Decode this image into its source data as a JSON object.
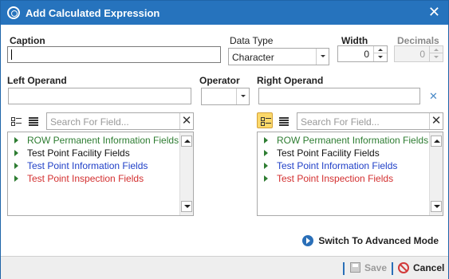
{
  "window": {
    "title": "Add Calculated Expression",
    "close_glyph": "✕"
  },
  "caption": {
    "label": "Caption",
    "value": ""
  },
  "data_type": {
    "label": "Data Type",
    "value": "Character"
  },
  "width": {
    "label": "Width",
    "value": "0"
  },
  "decimals": {
    "label": "Decimals",
    "value": "0"
  },
  "left_operand": {
    "label": "Left Operand",
    "value": ""
  },
  "operator": {
    "label": "Operator",
    "value": ""
  },
  "right_operand": {
    "label": "Right Operand",
    "value": "",
    "clear_glyph": "✕"
  },
  "search": {
    "placeholder": "Search For Field...",
    "clear_glyph": "✕"
  },
  "left_tree": {
    "items": [
      {
        "label": "ROW Permanent Information Fields",
        "color": "#2e7d32"
      },
      {
        "label": "Test Point Facility Fields",
        "color": "#111111"
      },
      {
        "label": "Test Point Information Fields",
        "color": "#1f3fc7"
      },
      {
        "label": "Test Point Inspection Fields",
        "color": "#d32f2f"
      }
    ]
  },
  "right_tree": {
    "items": [
      {
        "label": "ROW Permanent Information Fields",
        "color": "#2e7d32"
      },
      {
        "label": "Test Point Facility Fields",
        "color": "#111111"
      },
      {
        "label": "Test Point Information Fields",
        "color": "#1f3fc7"
      },
      {
        "label": "Test Point Inspection Fields",
        "color": "#d32f2f"
      }
    ]
  },
  "advanced": {
    "label": "Switch To Advanced Mode"
  },
  "footer": {
    "save_label": "Save",
    "cancel_label": "Cancel"
  }
}
